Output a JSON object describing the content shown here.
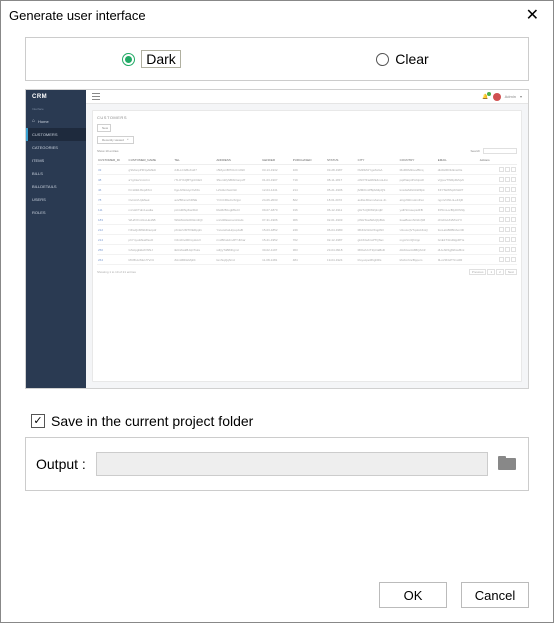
{
  "window": {
    "title": "Generate user interface"
  },
  "theme": {
    "options": {
      "dark": "Dark",
      "clear": "Clear"
    },
    "selected": "dark"
  },
  "preview": {
    "brand": "CRM",
    "section": "Interface",
    "nav": {
      "home": "Home",
      "customers": "CUSTOMERS",
      "categories": "CATEGORIES",
      "items": "ITEMS",
      "bills": "BILLS",
      "billdetails": "BILLDETAILS",
      "users": "USERS",
      "roles": "ROLES"
    },
    "user_label": "Admin",
    "card_title": "CUSTOMERS",
    "new_btn": "New",
    "filter": "Recently viewed",
    "show_prefix": "Show",
    "show_count": "10",
    "show_suffix": "entries",
    "search_label": "Search",
    "columns": {
      "id": "CUSTOMER_ID",
      "name": "CUSTOMER_NAME",
      "tel": "TEL",
      "address": "ADDRESS",
      "gender": "GENDER",
      "purchased": "PURCHASED",
      "status": "STATUS",
      "city": "CITY",
      "country": "COUNTRY",
      "email": "EMAIL",
      "actions": "Actions"
    },
    "rows": [
      {
        "id": "33",
        "name": "gSMonpPFNpAMkdt",
        "tel": "2JtLLCGBoKo67",
        "addr": "x5MyoriB7DzvCmWtI",
        "gen": "03-13-1932",
        "pur": "109",
        "st": "03-28-1987",
        "city": "hMZtMtJYgaSxGA",
        "cty": "MxZlDMZoovBfcq",
        "em": "dklJHlROkIknaOts"
      },
      {
        "id": "38",
        "name": "aYgCkeVxmrtnt",
        "tel": "rTLOYbQBTgnhCE3",
        "addr": "3NomRySBtbOonpdT",
        "gen": "01-03-1907",
        "pur": "719",
        "st": "08-11-1817",
        "city": "oWXTFteRRE4moHnn",
        "cty": "pqWtarptPmNpsR",
        "em": "vQpuvTWRpRZqvft"
      },
      {
        "id": "46",
        "name": "KCHIZdJbxpZXnt",
        "tel": "IIgoJcWxHycXvDG",
        "addr": "LZA3urihssOHr",
        "gen": "12-04-1441",
        "pur": "214",
        "st": "05-21-1906",
        "city": "jMMtKmPBpMdtpQS",
        "cty": "knxdwMrkCkWZpk",
        "em": "KFYSkWSpKNH37"
      },
      {
        "id": "78",
        "name": "OvnArzUpMsek",
        "tel": "auVBKsmchDNE",
        "addr": "YCCCRiwCvXcjpn",
        "gen": "24-06-2033",
        "pur": "822",
        "st": "18.01.2072",
        "city": "asDwJRonmAsrus.Jn",
        "cty": "aCgzbRmutnnFwt",
        "em": "ngmVnWLnLeFJjR"
      },
      {
        "id": "111",
        "name": "mzxHFTdm1esdta",
        "tel": "pzntdRNyZwcDAl",
        "addr": "RwMzBzogMlwCI",
        "gen": "09-07-1870",
        "pur": "316",
        "st": "06-12-1911",
        "city": "gIHTxQDWZpImjR",
        "cty": "yulFSCssepsdFB",
        "em": "FPFmLocBly0OhNly"
      },
      {
        "id": "183",
        "name": "WHAYFnULLLEJAB",
        "tel": "WGMAAGi0OHm3QI",
        "addr": "unrHtFEwmamOods",
        "gen": "07-31-1906",
        "pur": "306",
        "st": "02-01-1903",
        "city": "pWHTcadWuQfpBxk",
        "cty": "foaeBssmNOdnf)M",
        "em": "cFtxDuUN/MnnIYl"
      },
      {
        "id": "212",
        "name": "NKwQnMWkDnutpdr",
        "tel": "pKnkzUMTIVEDppl1",
        "addr": "YwvxwhwHrpupJaB",
        "gen": "15-03-1852",
        "pur": "249",
        "st": "06-04-1980",
        "city": "MbKGVkGVKqpWrl",
        "cty": "UJouLzjVTqdorkKoQ",
        "em": "fonLaGBFBDAm3D"
      },
      {
        "id": "214",
        "name": "phYnyuZAlaWsuO",
        "tel": "OJmDrvdDlmyHoUl",
        "addr": "rmxBKwtdmJPYJbhar",
        "gen": "15-21-1952",
        "pur": "702",
        "st": "02-12-1987",
        "city": "gkCKtwKroPTQNet",
        "cty": "mgmVnrQhtrpp",
        "em": "G1E1T3zsDkjpRTts"
      },
      {
        "id": "250",
        "name": "GScipgbkkzhWNJ",
        "tel": "iEUitAwkBJqCTuks",
        "addr": "sdQyToBfDFgmz",
        "gen": "30-02-1197",
        "pur": "363",
        "st": "23-04-0918",
        "city": "MlOwUxrTZpOaBsD",
        "cty": "diAbGonG6BQACZ",
        "em": "dUuJWJgjWbceBmi"
      },
      {
        "id": "264",
        "name": "MCBUurMuIJYVcU",
        "tel": "ZAmMRtHMpDt",
        "addr": "lsmNqQqNrnz",
        "gen": "11-08-1481",
        "pur": "484",
        "st": "19-04-1924",
        "city": "lrloyucpeMhghRls",
        "cty": "kfoKmhncBppom",
        "em": "IILoV3NxPTzvdJR"
      }
    ],
    "footer_text": "Showing 1 to 10 of 21 entries",
    "pager": {
      "prev": "Previous",
      "p1": "1",
      "p2": "2",
      "next": "Next"
    }
  },
  "save_label": "Save in the current project folder",
  "save_checked": true,
  "output_label": "Output :",
  "output_value": "",
  "buttons": {
    "ok": "OK",
    "cancel": "Cancel"
  }
}
